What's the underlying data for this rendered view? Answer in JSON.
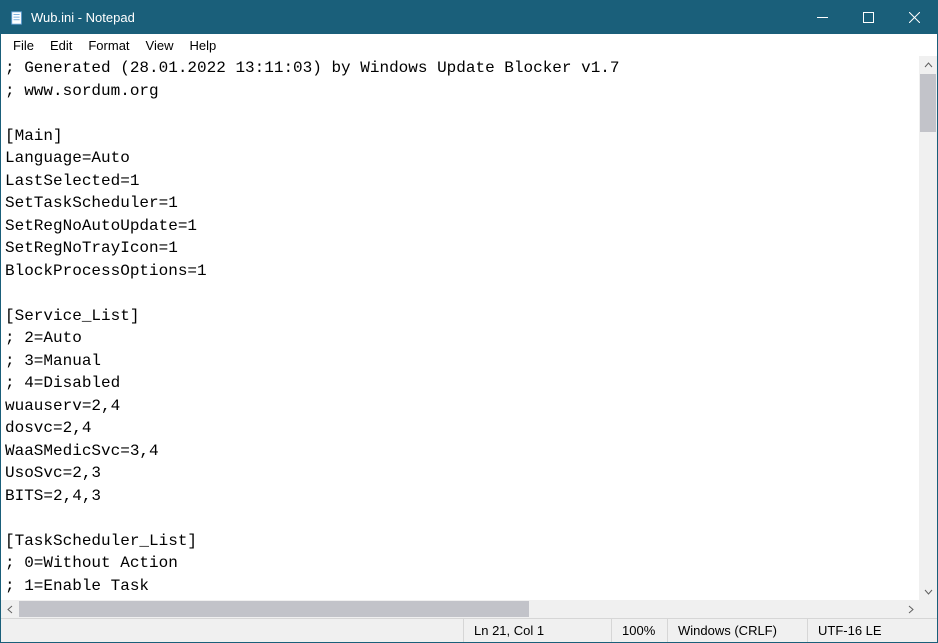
{
  "titlebar": {
    "title": "Wub.ini - Notepad"
  },
  "menubar": {
    "file": "File",
    "edit": "Edit",
    "format": "Format",
    "view": "View",
    "help": "Help"
  },
  "editor": {
    "content": "; Generated (28.01.2022 13:11:03) by Windows Update Blocker v1.7\n; www.sordum.org\n\n[Main]\nLanguage=Auto\nLastSelected=1\nSetTaskScheduler=1\nSetRegNoAutoUpdate=1\nSetRegNoTrayIcon=1\nBlockProcessOptions=1\n\n[Service_List]\n; 2=Auto\n; 3=Manual\n; 4=Disabled\nwuauserv=2,4\ndosvc=2,4\nWaaSMedicSvc=3,4\nUsoSvc=2,3\nBITS=2,4,3\n\n[TaskScheduler_List]\n; 0=Without Action\n; 1=Enable Task"
  },
  "statusbar": {
    "position": "Ln 21, Col 1",
    "zoom": "100%",
    "lineending": "Windows (CRLF)",
    "encoding": "UTF-16 LE"
  }
}
